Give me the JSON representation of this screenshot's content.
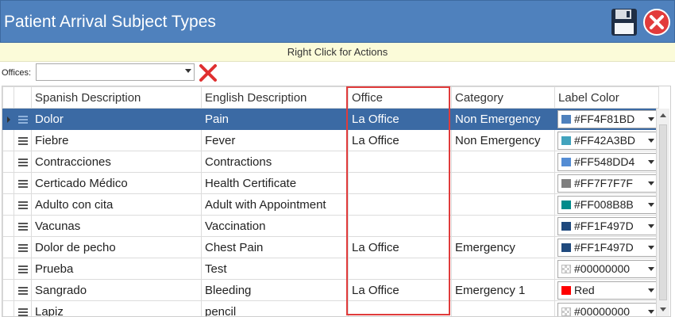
{
  "window": {
    "title": "Patient Arrival Subject Types"
  },
  "hint": "Right Click for Actions",
  "filter": {
    "offices_label": "Offices:",
    "offices_value": ""
  },
  "columns": [
    "Spanish Description",
    "English Description",
    "Office",
    "Category",
    "Label Color"
  ],
  "rows": [
    {
      "spanish": "Dolor",
      "english": "Pain",
      "office": "La Office",
      "category": "Non Emergency",
      "label_color": "#FF4F81BD",
      "swatch": "#4F81BD",
      "selected": true
    },
    {
      "spanish": "Fiebre",
      "english": "Fever",
      "office": "La Office",
      "category": "Non Emergency",
      "label_color": "#FF42A3BD",
      "swatch": "#42A3BD",
      "selected": false
    },
    {
      "spanish": "Contracciones",
      "english": "Contractions",
      "office": "",
      "category": "",
      "label_color": "#FF548DD4",
      "swatch": "#548DD4",
      "selected": false
    },
    {
      "spanish": "Certicado Médico",
      "english": "Health Certificate",
      "office": "",
      "category": "",
      "label_color": "#FF7F7F7F",
      "swatch": "#7F7F7F",
      "selected": false
    },
    {
      "spanish": "Adulto con cita",
      "english": "Adult with Appointment",
      "office": "",
      "category": "",
      "label_color": "#FF008B8B",
      "swatch": "#008B8B",
      "selected": false
    },
    {
      "spanish": "Vacunas",
      "english": "Vaccination",
      "office": "",
      "category": "",
      "label_color": "#FF1F497D",
      "swatch": "#1F497D",
      "selected": false
    },
    {
      "spanish": "Dolor de pecho",
      "english": "Chest Pain",
      "office": "La Office",
      "category": "Emergency",
      "label_color": "#FF1F497D",
      "swatch": "#1F497D",
      "selected": false
    },
    {
      "spanish": "Prueba",
      "english": "Test",
      "office": "",
      "category": "",
      "label_color": "#00000000",
      "swatch": "transparent",
      "selected": false
    },
    {
      "spanish": "Sangrado",
      "english": "Bleeding",
      "office": "La Office",
      "category": "Emergency 1",
      "label_color": "Red",
      "swatch": "#FF0000",
      "selected": false
    },
    {
      "spanish": "Lapiz",
      "english": "pencil",
      "office": "",
      "category": "",
      "label_color": "#00000000",
      "swatch": "transparent",
      "selected": false
    }
  ],
  "colors": {
    "title_bar": "#4F81BD",
    "hint_bar": "#FBFBD9",
    "selected_row": "#3B6AA4",
    "highlight": "#E03B3B"
  },
  "icons": {
    "save": "floppy-disk-icon",
    "close": "close-circle-icon",
    "clear": "red-x-icon",
    "row_handle": "drag-handle-icon"
  }
}
